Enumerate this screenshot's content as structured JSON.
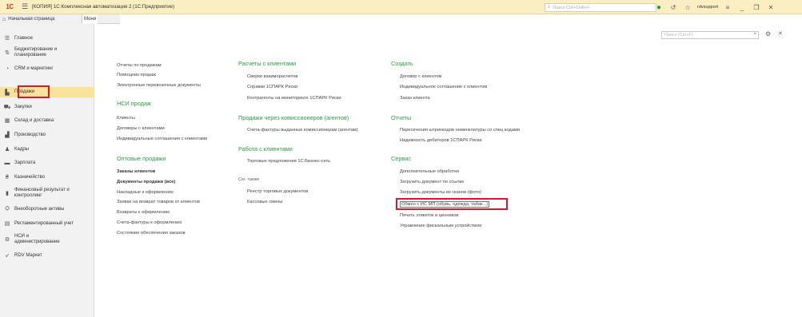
{
  "titlebar": {
    "logo": "1С",
    "title": "[КОПИЯ] 1С:Комплексная автоматизация 2  (1С:Предприятие)",
    "search_placeholder": "Поиск Ctrl+Shift+F",
    "user": "rdvsupport"
  },
  "tabs": {
    "home": "Начальная страница",
    "second": "Мони"
  },
  "nav": {
    "items": [
      {
        "label": "Главное",
        "icon": "menu-lines-icon"
      },
      {
        "label": "Бюджетирование и планирование",
        "icon": "budget-icon"
      },
      {
        "label": "CRM и маркетинг",
        "icon": "crm-icon"
      },
      {
        "label": "Продажи",
        "icon": "shopping-bag-icon"
      },
      {
        "label": "Закупки",
        "icon": "cart-icon"
      },
      {
        "label": "Склад и доставка",
        "icon": "warehouse-icon"
      },
      {
        "label": "Производство",
        "icon": "factory-icon"
      },
      {
        "label": "Кадры",
        "icon": "person-icon"
      },
      {
        "label": "Зарплата",
        "icon": "salary-icon"
      },
      {
        "label": "Казначейство",
        "icon": "treasury-icon"
      },
      {
        "label": "Финансовый результат и контроллинг",
        "icon": "chart-bars-icon"
      },
      {
        "label": "Внеоборотные активы",
        "icon": "assets-icon"
      },
      {
        "label": "Регламентированный учет",
        "icon": "ledger-icon"
      },
      {
        "label": "НСИ и администрирование",
        "icon": "gear-icon"
      },
      {
        "label": "RDV Маркет",
        "icon": "rocket-icon"
      }
    ]
  },
  "main": {
    "search_placeholder": "Поиск (Ctrl+F)",
    "col1": {
      "links_top": [
        "Отчеты по продажам",
        "Помощник продаж",
        "Электронные перевозочные документы"
      ],
      "nsi_title": "НСИ продаж",
      "nsi_links": [
        "Клиенты",
        "Договоры с клиентами",
        "Индивидуальные соглашения с клиентами"
      ],
      "wholesale_title": "Оптовые продажи",
      "wholesale_bold": [
        "Заказы клиентов",
        "Документы продажи (все)"
      ],
      "wholesale_links": [
        "Накладные к оформлению",
        "Заявки на возврат товаров от клиентов",
        "Возвраты к оформлению",
        "Счета-фактуры к оформлению",
        "Состояние обеспечения заказов"
      ]
    },
    "col2": {
      "calc_title": "Расчеты с клиентами",
      "calc_links": [
        "Сверки взаиморасчетов",
        "Справки 1СПАРК Риски",
        "Контрагенты на мониторинге 1СПАРК Риски"
      ],
      "agents_title": "Продажи через комиссионеров (агентов)",
      "agents_links": [
        "Счета-фактуры выданные комиссионерам (агентам)"
      ],
      "work_title": "Работа с клиентами",
      "work_links": [
        "Торговые предложения 1С:Бизнес-сеть"
      ],
      "see_also": "См. также",
      "see_links": [
        "Реестр торговых документов",
        "Кассовые смены"
      ]
    },
    "col3": {
      "create_title": "Создать",
      "create_links": [
        "Договор с клиентом",
        "Индивидуальное соглашение с клиентом",
        "Заказ клиента"
      ],
      "reports_title": "Отчеты",
      "reports_links": [
        "Пересечения штрихкодов номенклатуры со спец кодами",
        "Надежность дебиторов 1СПАРК Риски"
      ],
      "service_title": "Сервис",
      "service_links": [
        "Дополнительные обработки",
        "Загрузить документ по ссылке",
        "Загрузить документы из сканов (фото)",
        "Обмен с ИС МП (обувь, одежда, табак...)",
        "Печать этикеток и ценников",
        "Управление фискальным устройством"
      ]
    }
  }
}
